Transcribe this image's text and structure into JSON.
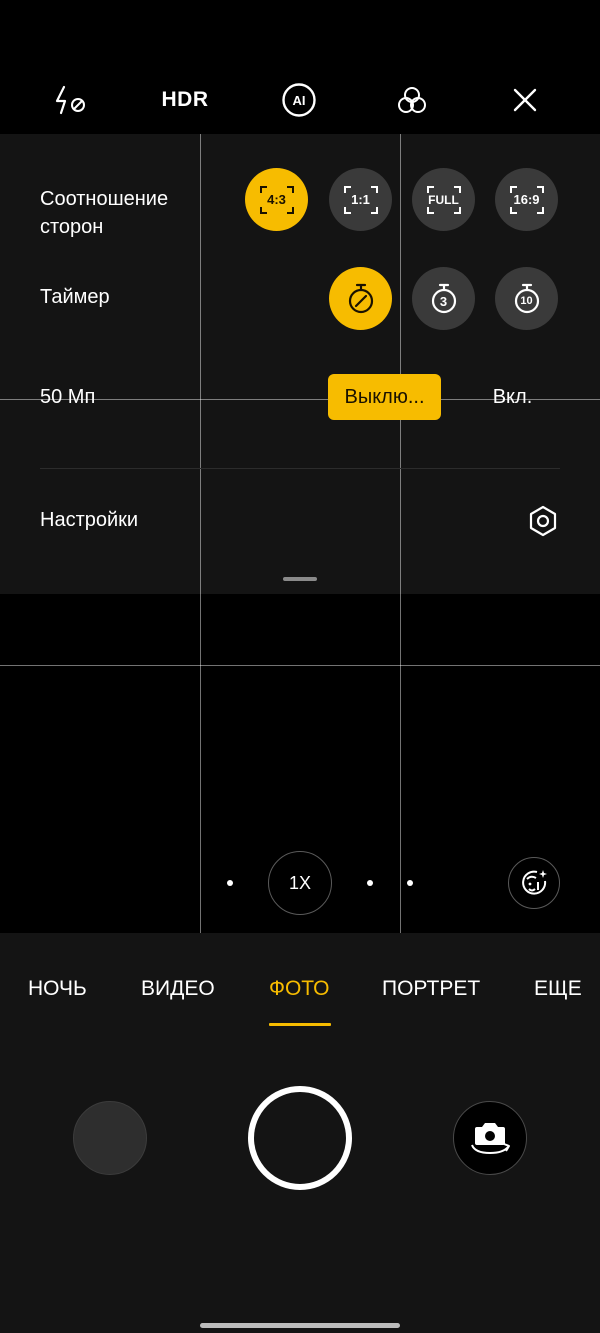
{
  "top_bar": {
    "flash_icon": "flash-off-icon",
    "hdr_label": "HDR",
    "ai_icon": "ai-icon",
    "ai_label": "AI",
    "filters_icon": "filters-icon",
    "close_icon": "close-icon"
  },
  "settings_panel": {
    "aspect_ratio": {
      "label": "Соотношение сторон",
      "options": [
        "4:3",
        "1:1",
        "FULL",
        "16:9"
      ],
      "selected": "4:3"
    },
    "timer": {
      "label": "Таймер",
      "options": [
        "off",
        "3",
        "10"
      ],
      "selected": "off",
      "option_3_label": "3",
      "option_10_label": "10"
    },
    "megapixels": {
      "label": "50 Мп",
      "off_label": "Выклю...",
      "on_label": "Вкл.",
      "selected": "off"
    },
    "settings": {
      "label": "Настройки",
      "icon": "hexagon-settings-icon"
    }
  },
  "viewfinder": {
    "zoom_label": "1X",
    "beauty_icon": "face-beauty-icon"
  },
  "modes": {
    "items": [
      "НОЧЬ",
      "ВИДЕО",
      "ФОТО",
      "ПОРТРЕТ",
      "ЕЩЕ"
    ],
    "active": "ФОТО"
  },
  "controls": {
    "gallery_icon": "gallery-thumbnail",
    "shutter_icon": "shutter-icon",
    "switch_icon": "switch-camera-icon"
  },
  "colors": {
    "accent": "#f7bc00",
    "panel_bg": "#141414",
    "button_bg": "#3a3a3a"
  }
}
